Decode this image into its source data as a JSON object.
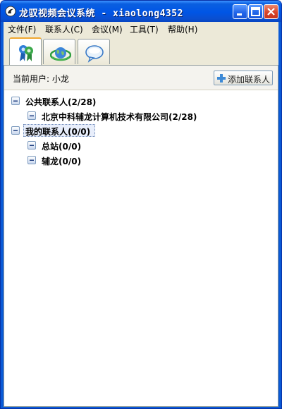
{
  "window": {
    "title": "龙驭视频会议系统 - xiaolong4352"
  },
  "menu": [
    {
      "label": "文件(F)"
    },
    {
      "label": "联系人(C)"
    },
    {
      "label": "会议(M)"
    },
    {
      "label": "工具(T)"
    },
    {
      "label": "帮助(H)"
    }
  ],
  "tabs": [
    {
      "icon": "contacts-badge-icon",
      "active": true
    },
    {
      "icon": "globe-network-icon",
      "active": false
    },
    {
      "icon": "chat-bubble-icon",
      "active": false
    }
  ],
  "userbar": {
    "current_user": "当前用户: 小龙",
    "add_contact": "添加联系人"
  },
  "tree": [
    {
      "label": "公共联系人(2/28)",
      "level": 0
    },
    {
      "label": "北京中科辅龙计算机技术有限公司(2/28)",
      "level": 1
    },
    {
      "label": "我的联系人(0/0)",
      "level": 0,
      "selected": true
    },
    {
      "label": "总站(0/0)",
      "level": 1
    },
    {
      "label": "辅龙(0/0)",
      "level": 1
    }
  ],
  "colors": {
    "titlebar": "#0055e5",
    "selection": "#e8eefb",
    "accent": "#f0a830"
  }
}
